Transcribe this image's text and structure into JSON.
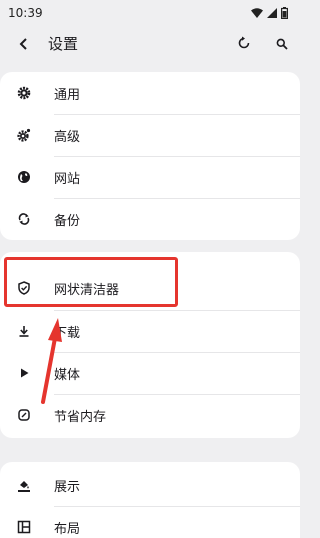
{
  "status_bar": {
    "time": "10:39"
  },
  "app_bar": {
    "title": "设置"
  },
  "sections": [
    {
      "items": [
        {
          "label": "通用",
          "icon": "gear-icon"
        },
        {
          "label": "高级",
          "icon": "advanced-gear-icon"
        },
        {
          "label": "网站",
          "icon": "globe-icon"
        },
        {
          "label": "备份",
          "icon": "sync-icon"
        }
      ]
    },
    {
      "items": [
        {
          "label": "网状清洁器",
          "icon": "shield-icon"
        },
        {
          "label": "下载",
          "icon": "download-icon"
        },
        {
          "label": "媒体",
          "icon": "play-icon"
        },
        {
          "label": "节省内存",
          "icon": "memory-icon"
        }
      ]
    },
    {
      "items": [
        {
          "label": "展示",
          "icon": "paint-bucket-icon"
        },
        {
          "label": "布局",
          "icon": "layout-icon"
        }
      ]
    }
  ],
  "colors": {
    "background": "#efeff1",
    "card": "#ffffff",
    "highlight": "#e5352e"
  }
}
